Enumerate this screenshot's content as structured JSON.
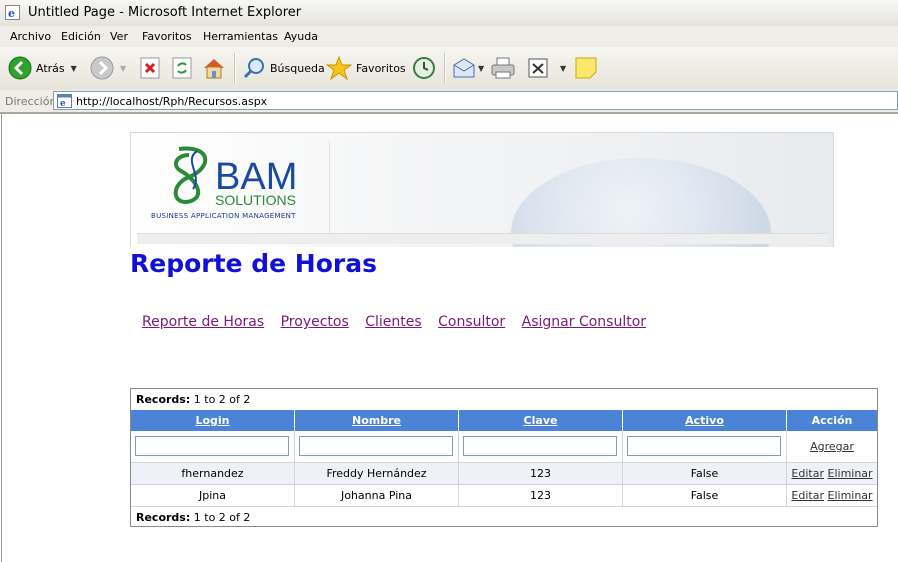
{
  "window": {
    "title": "Untitled Page - Microsoft Internet Explorer"
  },
  "menu": [
    "Archivo",
    "Edición",
    "Ver",
    "Favoritos",
    "Herramientas",
    "Ayuda"
  ],
  "toolbar": {
    "back_label": "Atrás",
    "search_label": "Búsqueda",
    "favorites_label": "Favoritos"
  },
  "address": {
    "label": "Dirección",
    "url": "http://localhost/Rph/Recursos.aspx"
  },
  "banner": {
    "brand": "BAM",
    "brand_sub": "SOLUTIONS",
    "tagline": "BUSINESS APPLICATION MANAGEMENT"
  },
  "page": {
    "title": "Reporte de Horas"
  },
  "nav": [
    "Reporte de Horas",
    "Proyectos",
    "Clientes",
    "Consultor",
    "Asignar Consultor"
  ],
  "grid": {
    "pager_label": "Records:",
    "pager_value": "1 to 2 of 2",
    "columns": [
      "Login",
      "Nombre",
      "Clave",
      "Activo",
      "Acción"
    ],
    "add_label": "Agregar",
    "rows": [
      {
        "login": "fhernandez",
        "nombre": "Freddy Hernández",
        "clave": "123",
        "activo": "False",
        "edit": "Editar",
        "delete": "Eliminar"
      },
      {
        "login": "Jpina",
        "nombre": "Johanna Pina",
        "clave": "123",
        "activo": "False",
        "edit": "Editar",
        "delete": "Eliminar"
      }
    ]
  },
  "colors": {
    "header_blue": "#4b84d6",
    "title_blue": "#1010d8",
    "link_purple": "#7a1a7a"
  }
}
